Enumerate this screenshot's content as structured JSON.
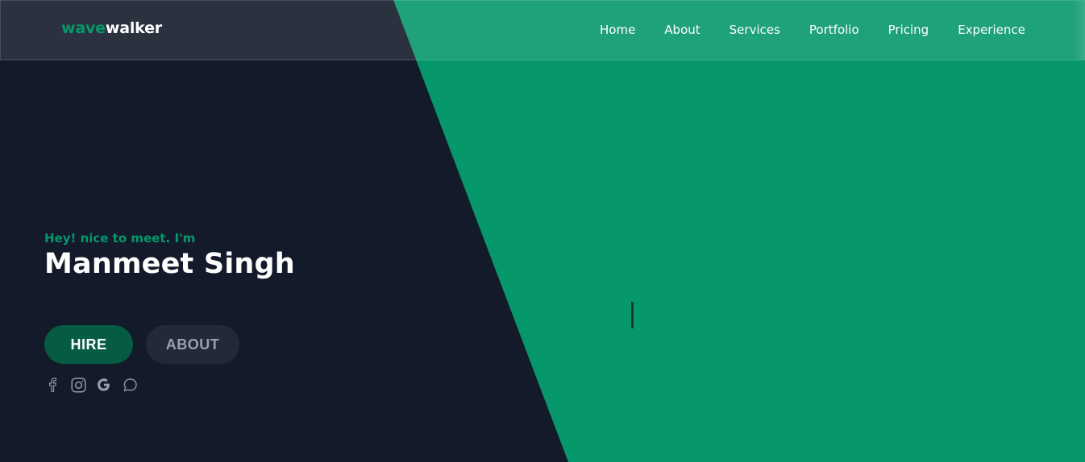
{
  "brand": {
    "part1": "wave",
    "part2": "walker"
  },
  "nav": {
    "items": [
      {
        "label": "Home"
      },
      {
        "label": "About"
      },
      {
        "label": "Services"
      },
      {
        "label": "Portfolio"
      },
      {
        "label": "Pricing"
      },
      {
        "label": "Experience"
      }
    ]
  },
  "hero": {
    "greeting": "Hey! nice to meet. I'm",
    "name": "Manmeet Singh",
    "hire_label": "HIRE",
    "about_label": "ABOUT",
    "typed_text": ""
  },
  "socials": [
    "facebook-icon",
    "instagram-icon",
    "google-icon",
    "chat-icon"
  ],
  "colors": {
    "accent": "#06976a",
    "background": "#131a29",
    "hire_button": "#055c43",
    "about_button": "#222a38"
  }
}
